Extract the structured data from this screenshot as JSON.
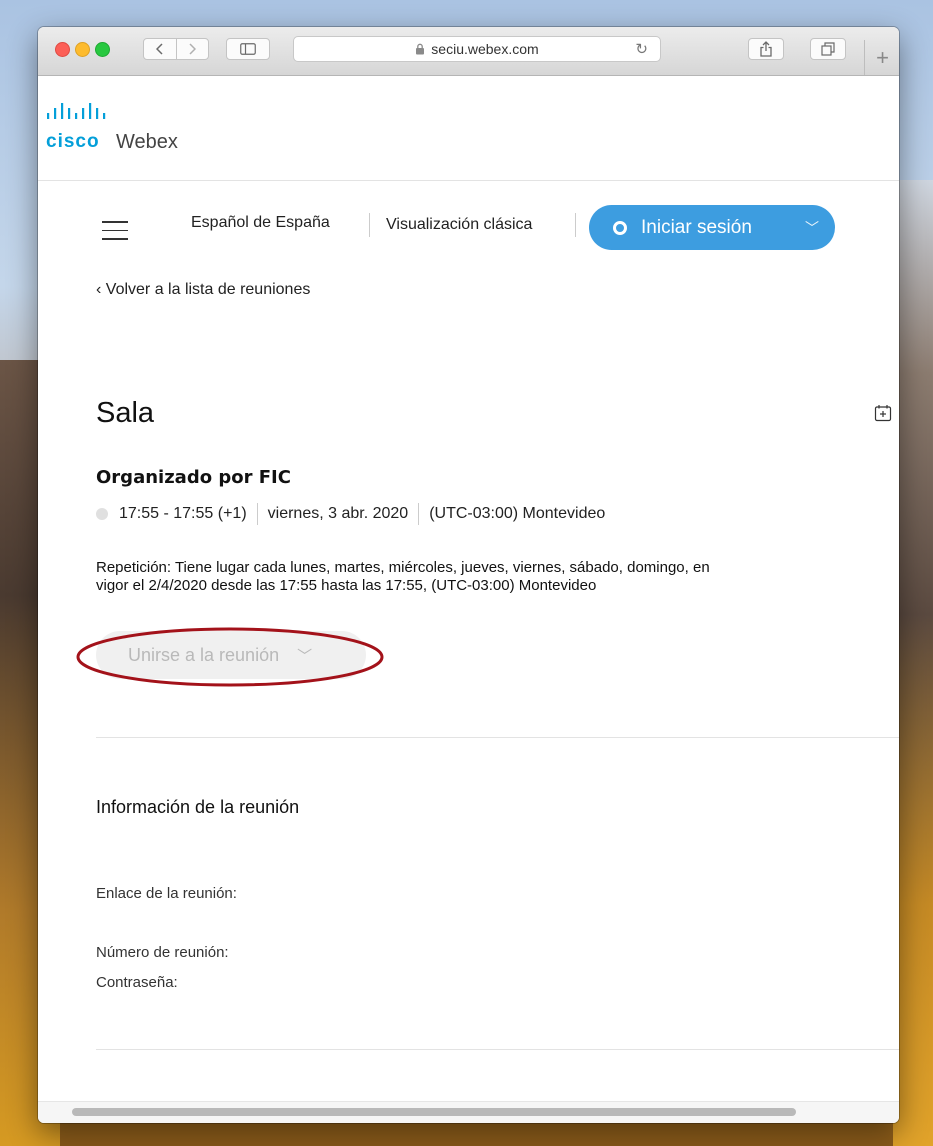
{
  "browser": {
    "url": "seciu.webex.com"
  },
  "brand": {
    "cisco": "cisco",
    "product": "Webex",
    "accent": "#049fd9"
  },
  "nav": {
    "language": "Español de España",
    "classic_view": "Visualización clásica",
    "sign_in": "Iniciar sesión",
    "sign_in_color": "#3d9de0"
  },
  "back_link": "Volver a la lista de reuniones",
  "back_chevron": "‹",
  "meeting": {
    "title": "Sala",
    "host": "Organizado por FIC",
    "time": "17:55 - 17:55 (+1)",
    "date": "viernes, 3 abr. 2020",
    "timezone": "(UTC-03:00) Montevideo",
    "recurrence_line1": "Repetición: Tiene lugar cada lunes, martes, miércoles, jueves, viernes, sábado, domingo, en",
    "recurrence_line2": "vigor el 2/4/2020 desde las 17:55 hasta las 17:55, (UTC-03:00) Montevideo",
    "join_button": "Unirse a la reunión"
  },
  "info": {
    "heading": "Información de la reunión",
    "link_label": "Enlace de la reunión:",
    "number_label": "Número de reunión:",
    "password_label": "Contraseña:"
  },
  "annotation_color": "#a3121a"
}
